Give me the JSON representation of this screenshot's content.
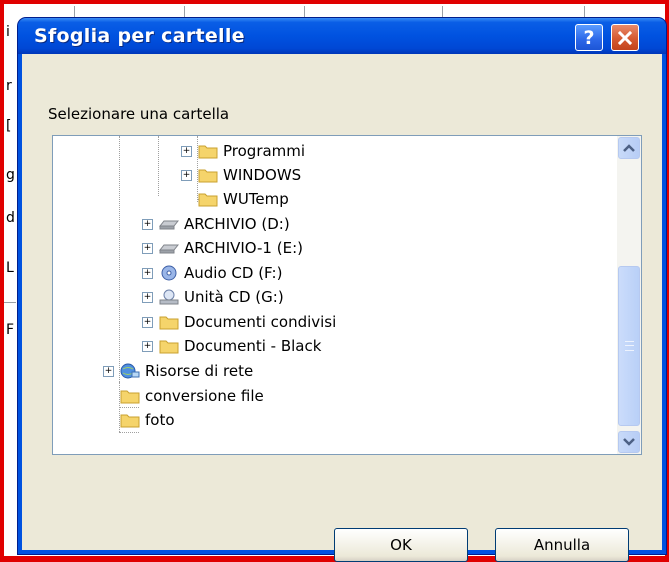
{
  "dialog": {
    "title": "Sfoglia per cartelle",
    "help_label": "?",
    "prompt": "Selezionare una cartella",
    "ok_label": "OK",
    "cancel_label": "Annulla"
  },
  "tree": [
    {
      "label": "Programmi",
      "icon": "folder-icon",
      "expandable": true
    },
    {
      "label": "WINDOWS",
      "icon": "folder-icon",
      "expandable": true
    },
    {
      "label": "WUTemp",
      "icon": "folder-icon",
      "expandable": false
    },
    {
      "label": "ARCHIVIO (D:)",
      "icon": "hard-drive-icon",
      "expandable": true
    },
    {
      "label": "ARCHIVIO-1 (E:)",
      "icon": "hard-drive-icon",
      "expandable": true
    },
    {
      "label": "Audio CD (F:)",
      "icon": "audio-cd-icon",
      "expandable": true
    },
    {
      "label": "Unità CD (G:)",
      "icon": "cd-drive-icon",
      "expandable": true
    },
    {
      "label": "Documenti condivisi",
      "icon": "folder-icon",
      "expandable": true
    },
    {
      "label": "Documenti - Black",
      "icon": "folder-icon",
      "expandable": true
    },
    {
      "label": "Risorse di rete",
      "icon": "network-icon",
      "expandable": true
    },
    {
      "label": "conversione file",
      "icon": "folder-icon",
      "expandable": false
    },
    {
      "label": "foto",
      "icon": "folder-icon",
      "expandable": false
    }
  ],
  "background": {
    "left_chars": [
      "i",
      "r",
      "[",
      "g",
      "d",
      "L",
      "F"
    ]
  },
  "colors": {
    "frame": "#e00000",
    "titlebar": "#0052e0",
    "dialog_body": "#ece9d8",
    "folder": "#f5d46b"
  }
}
